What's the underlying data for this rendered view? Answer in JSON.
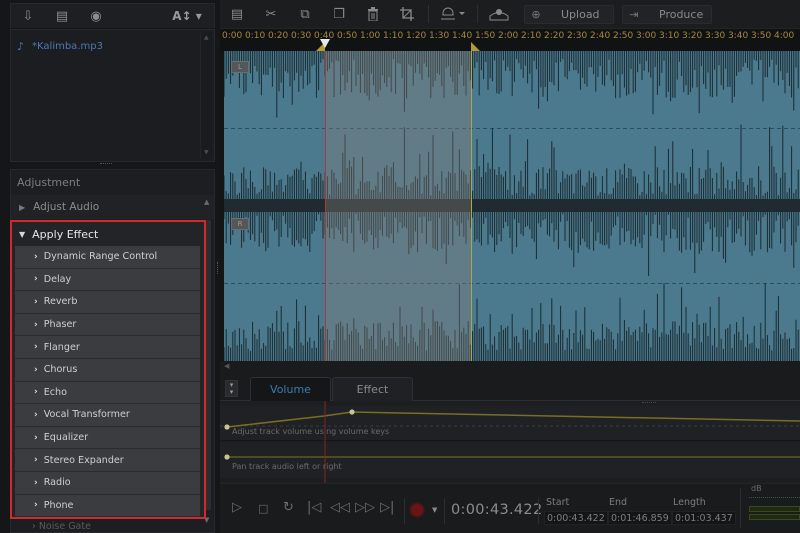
{
  "library": {
    "toolbar": [
      {
        "name": "import-media-icon",
        "glyph": "⇩"
      },
      {
        "name": "export-icon",
        "glyph": "▤"
      },
      {
        "name": "download-cd-icon",
        "glyph": "◉"
      }
    ],
    "font_button": "A↕ ▾",
    "files": [
      {
        "label": "*Kalimba.mp3",
        "icon": "♪"
      }
    ]
  },
  "adjustment": {
    "title": "Adjustment",
    "sections": [
      {
        "label": "Adjust Audio",
        "expanded": false
      },
      {
        "label": "Apply Effect",
        "expanded": true
      }
    ],
    "effects": [
      "Dynamic Range Control",
      "Delay",
      "Reverb",
      "Phaser",
      "Flanger",
      "Chorus",
      "Echo",
      "Vocal Transformer",
      "Equalizer",
      "Stereo Expander",
      "Radio",
      "Phone"
    ],
    "next_effect_partial": "Noise Gate"
  },
  "toolbar": {
    "icons": [
      {
        "name": "document-settings-icon",
        "glyph": "▤"
      },
      {
        "name": "cut-icon",
        "glyph": "✂"
      },
      {
        "name": "copy-icon",
        "glyph": "⧉"
      },
      {
        "name": "paste-icon",
        "glyph": "❐"
      },
      {
        "name": "delete-icon",
        "glyph": "🗑"
      },
      {
        "name": "crop-icon",
        "glyph": "⌗"
      }
    ],
    "upload_label": "Upload",
    "produce_label": "Produce"
  },
  "timeline": {
    "ticks": [
      "0:00",
      "0:10",
      "0:20",
      "0:30",
      "0:40",
      "0:50",
      "1:00",
      "1:10",
      "1:20",
      "1:30",
      "1:40",
      "1:50",
      "2:00",
      "2:10",
      "2:20",
      "2:30",
      "2:40",
      "2:50",
      "3:00",
      "3:10",
      "3:20",
      "3:30",
      "3:40",
      "3:50",
      "4:00"
    ],
    "channels": [
      "L",
      "R"
    ],
    "selection_start_s": 43.422,
    "selection_end_s": 106.859,
    "playhead_s": 43.422
  },
  "tabs": [
    {
      "label": "Volume",
      "active": true
    },
    {
      "label": "Effect",
      "active": false
    }
  ],
  "envelopes": {
    "volume_hint": "Adjust track volume using volume keys",
    "pan_hint": "Pan track audio left or right"
  },
  "transport": {
    "timecode": "0:00:43.422",
    "start_label": "Start",
    "start_value": "0:00:43.422",
    "end_label": "End",
    "end_value": "0:01:46.859",
    "length_label": "Length",
    "length_value": "0:01:03.437",
    "db_label": "dB"
  },
  "colors": {
    "waveform_bg": "#4b7a8e",
    "selection_outline": "#d22a2a",
    "ruler_text": "#a3893b",
    "playhead": "#b63434",
    "active_tab": "#3a7cae"
  }
}
